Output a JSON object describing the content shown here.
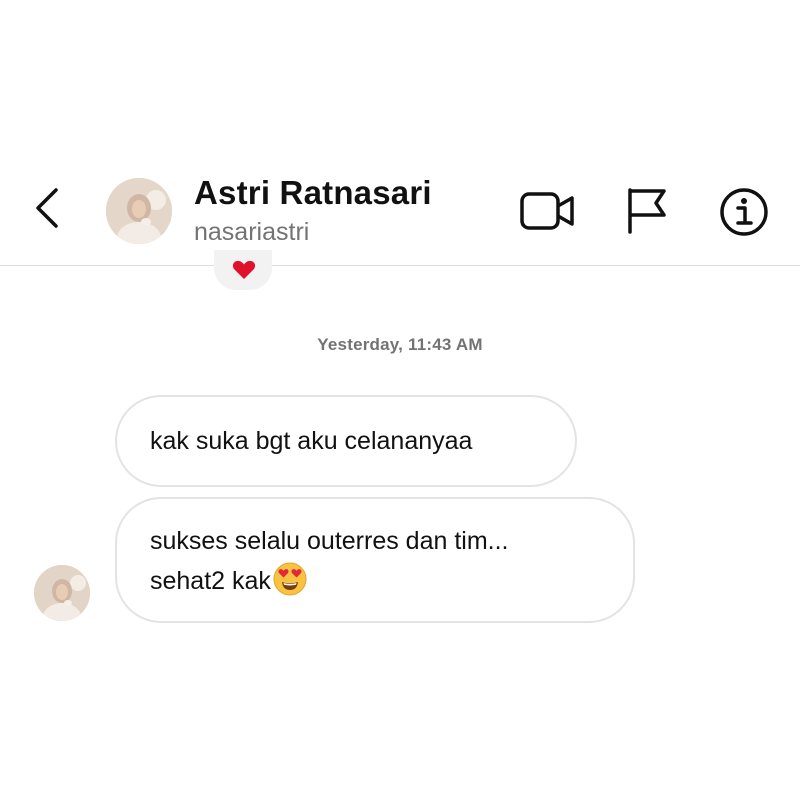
{
  "header": {
    "name": "Astri Ratnasari",
    "username": "nasariastri",
    "icons": [
      "chevron-left-icon",
      "video-camera-icon",
      "flag-icon",
      "info-icon"
    ]
  },
  "reaction": {
    "emoji": "heart",
    "color": "#e0112b"
  },
  "conversation": {
    "timestamp": "Yesterday, 11:43 AM",
    "messages": [
      {
        "lines": [
          "kak suka bgt aku celananyaa"
        ]
      },
      {
        "lines": [
          "sukses selalu outerres dan tim...",
          "sehat2 kak"
        ],
        "trailing_emoji": "smiling-face-with-heart-eyes"
      }
    ]
  },
  "colors": {
    "bubble_border": "#e3e3e3",
    "secondary_text": "#737373",
    "divider": "#dedede"
  }
}
